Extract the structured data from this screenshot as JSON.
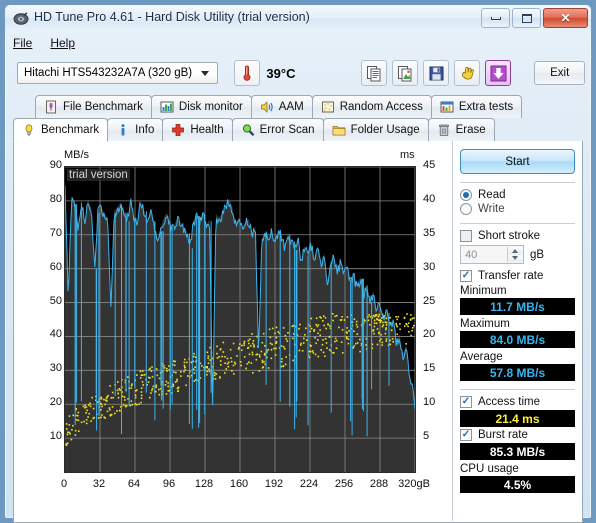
{
  "window": {
    "title": "HD Tune Pro 4.61 - Hard Disk Utility (trial version)",
    "icon": "hdd-icon",
    "minimize_label": "Minimize",
    "maximize_label": "Maximize",
    "close_label": "Close"
  },
  "menu": {
    "items": [
      {
        "label": "File",
        "accel": "F"
      },
      {
        "label": "Help",
        "accel": "H"
      }
    ]
  },
  "toolbar": {
    "drive": "Hitachi HTS543232A7A    (320 gB)",
    "temperature": "39°C",
    "thermometer_icon": "thermometer-icon",
    "buttons": [
      {
        "name": "copy-text-button",
        "icon": "copy-text-icon"
      },
      {
        "name": "copy-image-button",
        "icon": "copy-image-icon"
      },
      {
        "name": "save-button",
        "icon": "floppy-save-icon"
      },
      {
        "name": "cleanup-button",
        "icon": "hand-wave-icon"
      },
      {
        "name": "download-button",
        "icon": "download-arrow-icon"
      }
    ],
    "exit_label": "Exit"
  },
  "tabs": {
    "row1": [
      {
        "label": "File Benchmark",
        "icon": "file-benchmark-icon",
        "active": false
      },
      {
        "label": "Disk monitor",
        "icon": "disk-monitor-icon",
        "active": false
      },
      {
        "label": "AAM",
        "icon": "speaker-icon",
        "active": false
      },
      {
        "label": "Random Access",
        "icon": "random-access-icon",
        "active": false
      },
      {
        "label": "Extra tests",
        "icon": "extra-tests-icon",
        "active": false
      }
    ],
    "row2": [
      {
        "label": "Benchmark",
        "icon": "lightbulb-icon",
        "active": true
      },
      {
        "label": "Info",
        "icon": "info-icon",
        "active": false
      },
      {
        "label": "Health",
        "icon": "health-cross-icon",
        "active": false
      },
      {
        "label": "Error Scan",
        "icon": "magnifier-icon",
        "active": false
      },
      {
        "label": "Folder Usage",
        "icon": "folder-icon",
        "active": false
      },
      {
        "label": "Erase",
        "icon": "trash-icon",
        "active": false
      }
    ]
  },
  "panel": {
    "start_label": "Start",
    "mode_read": "Read",
    "mode_write": "Write",
    "short_stroke_label": "Short stroke",
    "short_stroke_value": "40",
    "short_stroke_unit": "gB",
    "transfer_rate_label": "Transfer rate",
    "minimum_label": "Minimum",
    "minimum_value": "11.7 MB/s",
    "maximum_label": "Maximum",
    "maximum_value": "84.0 MB/s",
    "average_label": "Average",
    "average_value": "57.8 MB/s",
    "access_time_label": "Access time",
    "access_time_value": "21.4 ms",
    "burst_rate_label": "Burst rate",
    "burst_rate_value": "85.3 MB/s",
    "cpu_usage_label": "CPU usage",
    "cpu_usage_value": "4.5%"
  },
  "chart_data": {
    "type": "line",
    "title": "",
    "watermark": "trial version",
    "ylabel": "MB/s",
    "y2label": "ms",
    "xlabel": "gB",
    "xlim": [
      0,
      320
    ],
    "ylim": [
      0,
      90
    ],
    "y2lim": [
      0,
      45
    ],
    "yticks": [
      10,
      20,
      30,
      40,
      50,
      60,
      70,
      80,
      90
    ],
    "y2ticks": [
      5,
      10,
      15,
      20,
      25,
      30,
      35,
      40,
      45
    ],
    "xticks": [
      0,
      32,
      64,
      96,
      128,
      160,
      192,
      224,
      256,
      288,
      320
    ],
    "xtick_suffix": "gB",
    "grid": true,
    "plot_bg": "#000000",
    "band_bg": "#333333",
    "series": [
      {
        "name": "Transfer rate",
        "color": "#3cb4ec",
        "axis": "left",
        "units": "MB/s",
        "x": [
          0,
          3,
          6,
          9,
          12,
          15,
          18,
          21,
          24,
          27,
          30,
          33,
          36,
          39,
          42,
          45,
          48,
          51,
          54,
          57,
          60,
          63,
          66,
          69,
          72,
          75,
          78,
          81,
          84,
          87,
          90,
          93,
          96,
          99,
          102,
          105,
          108,
          111,
          114,
          117,
          120,
          123,
          126,
          129,
          132,
          135,
          138,
          141,
          144,
          147,
          150,
          153,
          156,
          159,
          162,
          165,
          168,
          171,
          174,
          177,
          180,
          183,
          186,
          189,
          192,
          195,
          198,
          201,
          204,
          207,
          210,
          213,
          216,
          219,
          222,
          225,
          228,
          231,
          234,
          237,
          240,
          243,
          246,
          249,
          252,
          255,
          258,
          261,
          264,
          267,
          270,
          273,
          276,
          279,
          282,
          285,
          288,
          291,
          294,
          297,
          300,
          303,
          306,
          309,
          312,
          315,
          318,
          320
        ],
        "y": [
          84.0,
          51.0,
          80.5,
          79.0,
          71.0,
          79.5,
          73.5,
          80.0,
          77.0,
          60.0,
          76.5,
          78.0,
          75.5,
          74.5,
          49.0,
          76.5,
          77.5,
          79.0,
          76.5,
          74.0,
          79.5,
          75.0,
          73.0,
          79.5,
          77.0,
          73.5,
          76.5,
          74.0,
          68.0,
          71.0,
          74.0,
          76.0,
          73.0,
          71.5,
          74.0,
          73.5,
          72.0,
          70.5,
          66.0,
          73.0,
          75.5,
          74.0,
          76.0,
          72.0,
          74.0,
          19.0,
          75.5,
          74.5,
          76.0,
          78.0,
          80.0,
          77.5,
          73.0,
          74.5,
          71.5,
          73.5,
          74.0,
          70.0,
          72.0,
          35.0,
          68.0,
          70.0,
          69.0,
          70.5,
          67.0,
          71.0,
          69.5,
          66.0,
          70.0,
          68.0,
          65.5,
          69.0,
          62.0,
          66.0,
          64.0,
          67.0,
          63.0,
          65.5,
          61.0,
          64.0,
          56.0,
          62.0,
          63.0,
          59.0,
          61.5,
          58.0,
          60.0,
          56.5,
          58.0,
          54.0,
          57.0,
          52.0,
          55.0,
          50.0,
          53.0,
          47.0,
          50.0,
          44.0,
          47.0,
          42.0,
          44.0,
          38.0,
          40.0,
          34.0,
          37.0,
          28.0,
          24.0,
          20.0
        ],
        "min": 11.7,
        "max": 84.0,
        "avg": 57.8,
        "dip_note": "frequent vertical dips down to 10-25 MB/s across the whole span"
      },
      {
        "name": "Access time",
        "color": "#f2e420",
        "axis": "right",
        "units": "ms",
        "marker": "dot",
        "average": 21.4,
        "scatter_range_ms": [
          5,
          23
        ],
        "scatter_density": "dense cloud rising from ~6 ms at 0 gB to ~22 ms near 320 gB"
      }
    ]
  }
}
